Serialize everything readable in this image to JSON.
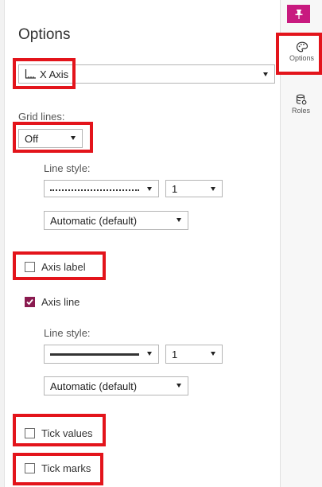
{
  "panel": {
    "title": "Options"
  },
  "rail": {
    "tabs": [
      {
        "label": "Options",
        "icon": "options-palette-icon"
      },
      {
        "label": "Roles",
        "icon": "roles-database-icon"
      }
    ],
    "pin_icon": "pin-icon",
    "accent_color": "#c81a7f",
    "highlight_color": "#e3141b"
  },
  "axis_select": {
    "value": "X Axis",
    "icon": "x-axis-icon"
  },
  "grid": {
    "label": "Grid lines:",
    "value": "Off",
    "line_style_label": "Line style:",
    "line_width": "1",
    "color": "Automatic (default)"
  },
  "axis_label": {
    "label": "Axis label",
    "checked": false
  },
  "axis_line": {
    "label": "Axis line",
    "checked": true,
    "line_style_label": "Line style:",
    "line_width": "1",
    "color": "Automatic (default)"
  },
  "tick_values": {
    "label": "Tick values",
    "checked": false
  },
  "tick_marks": {
    "label": "Tick marks",
    "checked": false
  }
}
